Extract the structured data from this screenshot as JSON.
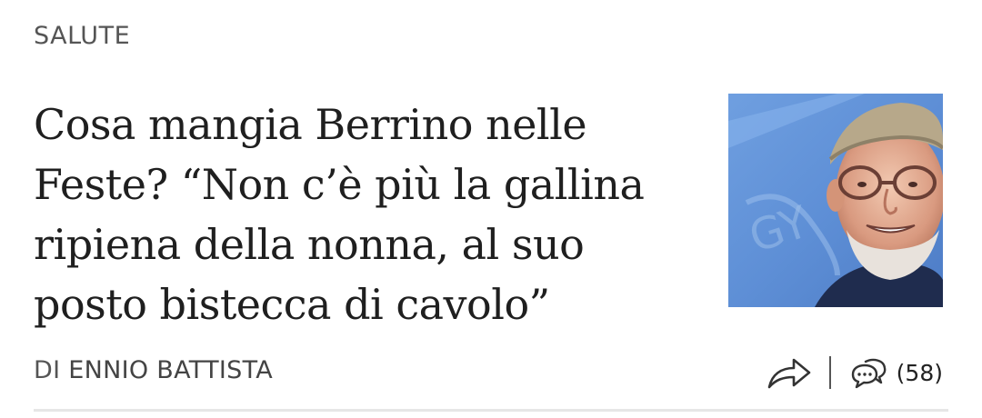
{
  "article": {
    "category": "SALUTE",
    "headline": "Cosa mangia Berrino nelle Feste? “Non c’è più la gallina ripiena della nonna, al suo posto bistecca di cavolo”",
    "byline_prefix": "DI",
    "author": "ENNIO BATTISTA",
    "comment_count": "(58)",
    "thumbnail_icon": "photo-of-older-man-in-cap"
  },
  "actions": {
    "share_icon": "share-arrow-icon",
    "comments_icon": "speech-bubbles-icon"
  }
}
